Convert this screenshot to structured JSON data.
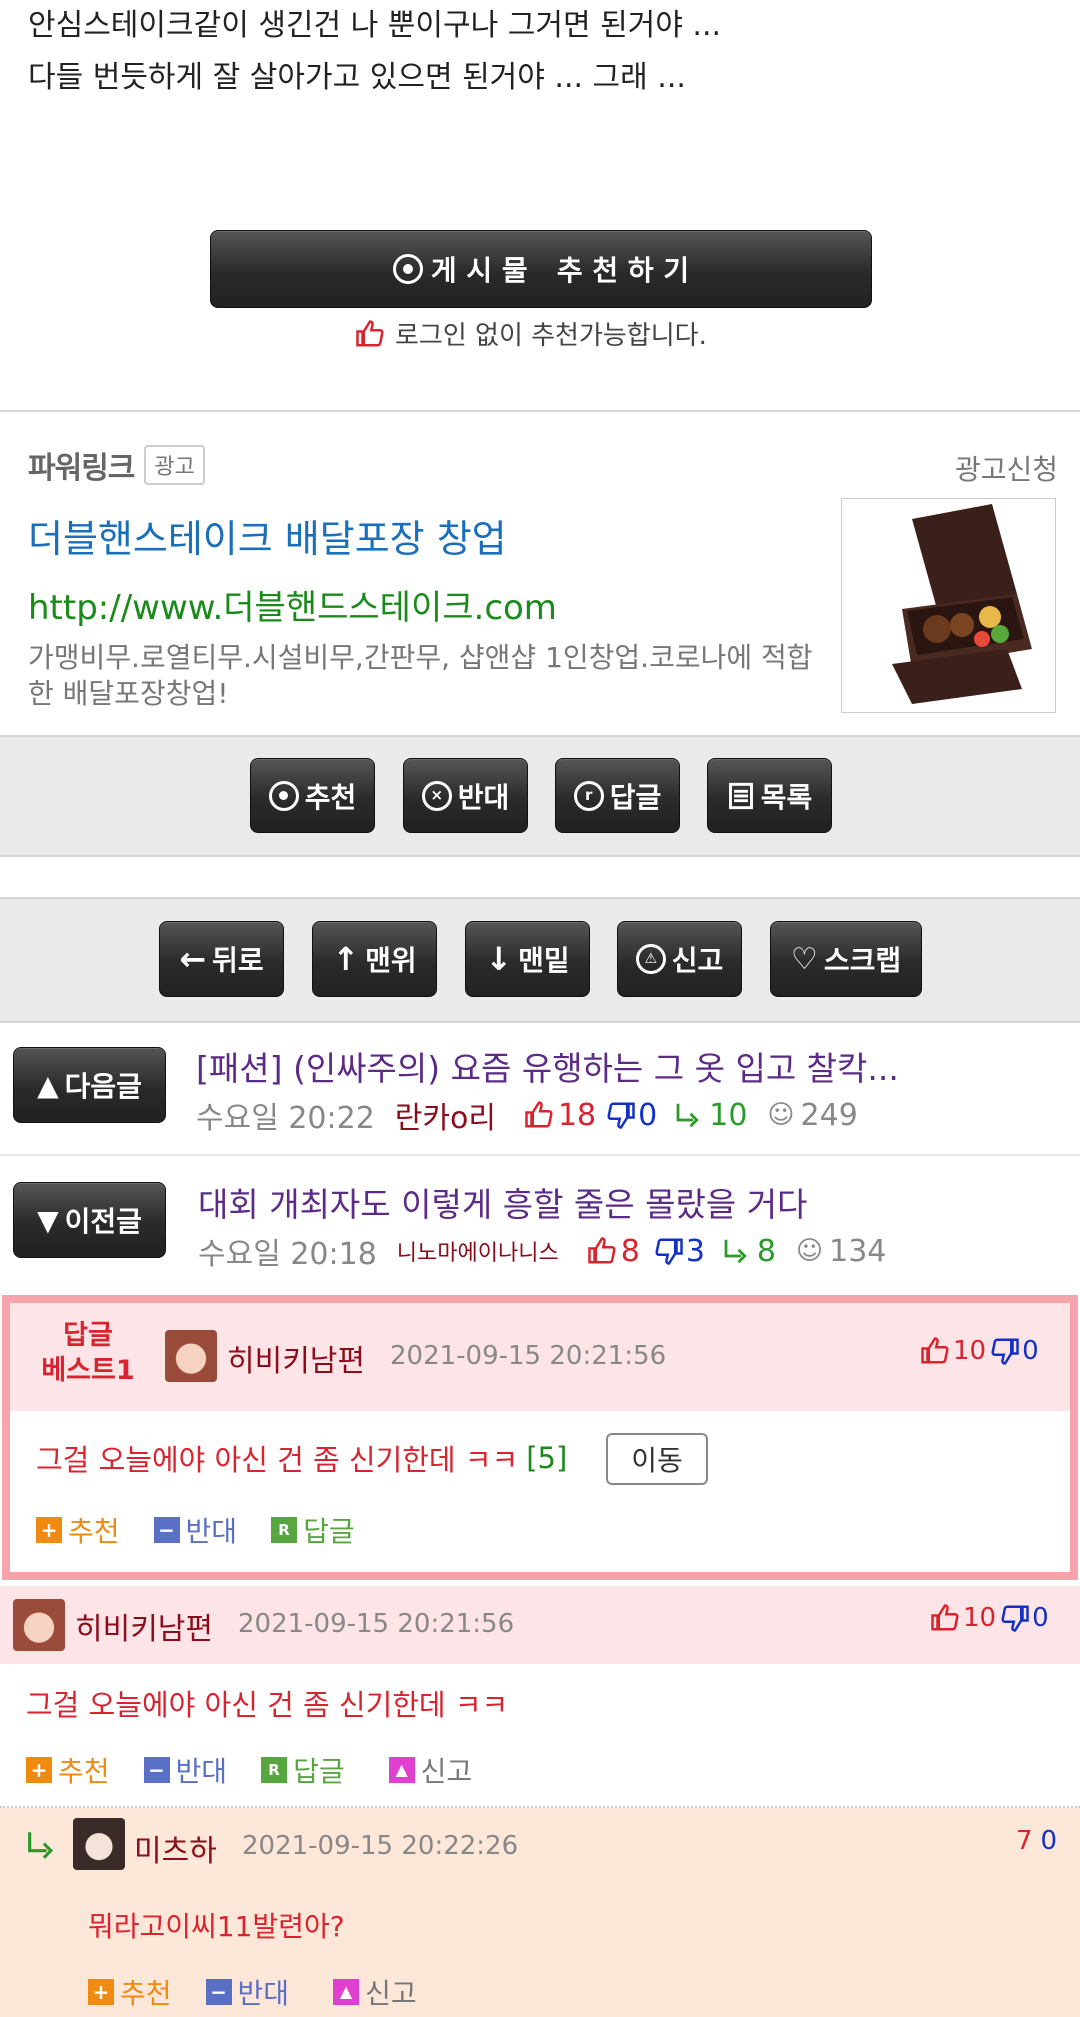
{
  "post": {
    "body_line1": "안심스테이크같이 생긴건 나 뿐이구나 그거면 된거야 ...",
    "body_line2": "다들 번듯하게 잘 살아가고 있으면 된거야 ... 그래 ...",
    "recommend_button": "게 시 물   추 천 하 기",
    "recommend_note": "로그인 없이 추천가능합니다."
  },
  "ad": {
    "header": "파워링크",
    "badge": "광고",
    "apply": "광고신청",
    "title": "더블핸스테이크 배달포장 창업",
    "url": "http://www.더블핸드스테이크.com",
    "desc": "가맹비무.로열티무.시설비무,간판무, 샵앤샵 1인창업.코로나에 적합한 배달포장창업!",
    "image_label": "W Hand Steak"
  },
  "actions": {
    "recommend": "추천",
    "oppose": "반대",
    "reply": "답글",
    "list": "목록"
  },
  "nav": {
    "back": "뒤로",
    "top": "맨위",
    "bottom": "맨밑",
    "report": "신고",
    "scrap": "스크랩"
  },
  "next_post": {
    "label": "다음글",
    "title": "[패션] (인싸주의) 요즘 유행하는 그 옷 입고 찰칵...",
    "time": "수요일 20:22",
    "author": "란카o리",
    "likes": "18",
    "dislikes": "0",
    "replies": "10",
    "views": "249"
  },
  "prev_post": {
    "label": "이전글",
    "title": "대회 개최자도 이렇게 흥할 줄은 몰랐을 거다",
    "time": "수요일 20:18",
    "author": "니노마에이나니스",
    "likes": "8",
    "dislikes": "3",
    "replies": "8",
    "views": "134"
  },
  "best_comment": {
    "label_line1": "답글",
    "label_line2": "베스트1",
    "author": "히비키남편",
    "time": "2021-09-15 20:21:56",
    "likes": "10",
    "dislikes": "0",
    "text": "그걸 오늘에야 아신 건 좀 신기한데 ㅋㅋ",
    "count": "[5]",
    "move": "이동",
    "recommend": "추천",
    "oppose": "반대",
    "reply": "답글"
  },
  "comment1": {
    "author": "히비키남편",
    "time": "2021-09-15 20:21:56",
    "likes": "10",
    "dislikes": "0",
    "text": "그걸 오늘에야 아신 건 좀 신기한데 ㅋㅋ",
    "recommend": "추천",
    "oppose": "반대",
    "reply": "답글",
    "report": "신고"
  },
  "comment2": {
    "author": "미츠하",
    "time": "2021-09-15 20:22:26",
    "likes": "7",
    "dislikes": "0",
    "text": "뭐라고이씨11발련아?",
    "recommend": "추천",
    "oppose": "반대",
    "report": "신고"
  },
  "colors": {
    "link_blue": "#1a6fbd",
    "link_green": "#1a8a1a",
    "purple": "#5c2a87",
    "red": "#d9232e",
    "blue": "#1330c7",
    "green": "#2a9a2a",
    "best_bg": "#fde4e6",
    "best_border": "#f6a4ab",
    "reply_bg": "#fce7d8"
  }
}
